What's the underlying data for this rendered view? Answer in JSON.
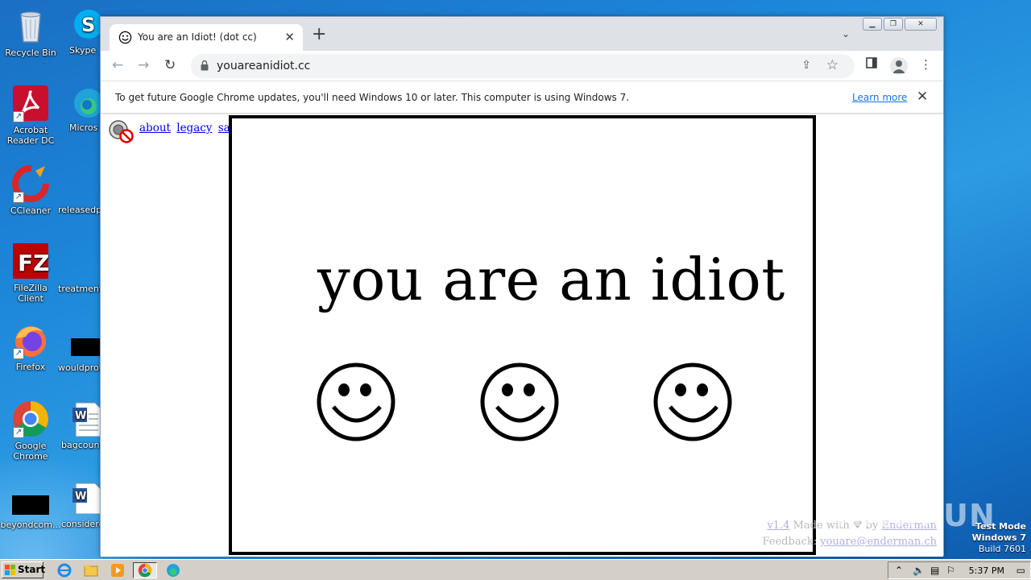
{
  "desktop": {
    "icons": [
      {
        "label": "Recycle Bin"
      },
      {
        "label": "Skype"
      },
      {
        "label": "Acrobat Reader DC"
      },
      {
        "label": "Microsoft"
      },
      {
        "label": "CCleaner"
      },
      {
        "label": "releasedp"
      },
      {
        "label": "FileZilla Client"
      },
      {
        "label": "treatment"
      },
      {
        "label": "Firefox"
      },
      {
        "label": "wouldprot"
      },
      {
        "label": "Google Chrome"
      },
      {
        "label": "bagcound"
      },
      {
        "label": "beyondcom..."
      },
      {
        "label": "considere"
      }
    ]
  },
  "browser": {
    "tab": {
      "title": "You are an Idiot! (dot cc)",
      "close_label": "✕"
    },
    "new_tab_label": "+",
    "address": {
      "url": "youareanidiot.cc"
    },
    "infobar": {
      "message": "To get future Google Chrome updates, you'll need Windows 10 or later. This computer is using Windows 7.",
      "learn_more": "Learn more",
      "close": "✕"
    }
  },
  "page": {
    "links": [
      "about",
      "legacy",
      "safe"
    ],
    "headline": "you are an idiot",
    "smiley_count": 3,
    "footer": {
      "version": "v1.4",
      "made_with": "Made with",
      "by": "by",
      "author": "Enderman",
      "feedback_label": "Feedback:",
      "feedback_email": "youare@enderman.ch"
    }
  },
  "watermark": {
    "text": "ANY.RUN"
  },
  "system": {
    "test_mode": "Test Mode",
    "os": "Windows 7",
    "build": "Build 7601",
    "clock": "5:37 PM",
    "start_label": "Start"
  },
  "colors": {
    "taskbar": "#d4d0c8",
    "link": "#0000ee",
    "desktop": "#1c86d8"
  }
}
